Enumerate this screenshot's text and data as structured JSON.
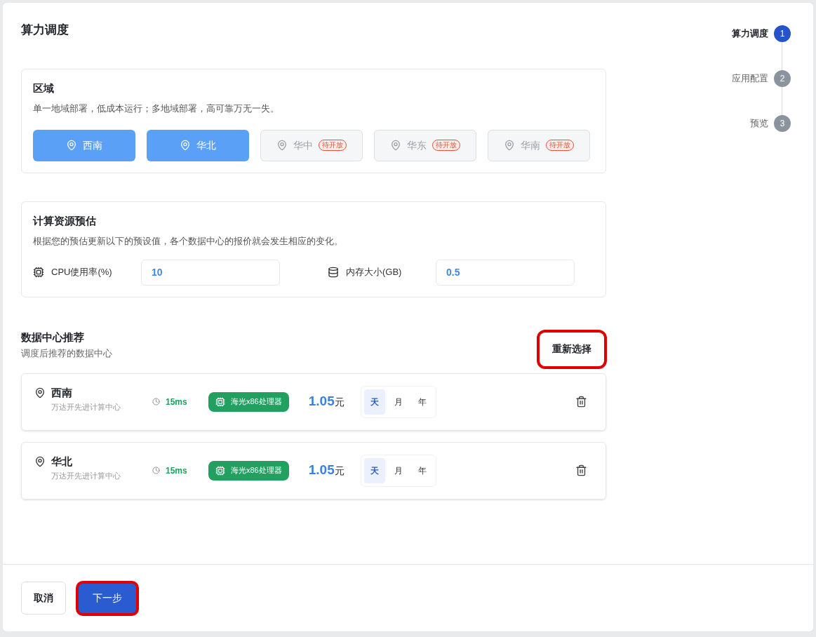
{
  "page_title": "算力调度",
  "steps": [
    {
      "label": "算力调度",
      "number": "1",
      "selected": true
    },
    {
      "label": "应用配置",
      "number": "2",
      "selected": false
    },
    {
      "label": "预览",
      "number": "3",
      "selected": false
    }
  ],
  "region": {
    "title": "区域",
    "description": "单一地域部署，低成本运行；多地域部署，高可靠万无一失。",
    "options": [
      {
        "label": "西南",
        "selected": true,
        "disabled": false
      },
      {
        "label": "华北",
        "selected": true,
        "disabled": false
      },
      {
        "label": "华中",
        "selected": false,
        "disabled": true,
        "badge": "待开放"
      },
      {
        "label": "华东",
        "selected": false,
        "disabled": true,
        "badge": "待开放"
      },
      {
        "label": "华南",
        "selected": false,
        "disabled": true,
        "badge": "待开放"
      }
    ]
  },
  "estimate": {
    "title": "计算资源预估",
    "description": "根据您的预估更新以下的预设值，各个数据中心的报价就会发生相应的变化。",
    "fields": [
      {
        "kind": "cpu",
        "label": "CPU使用率(%)",
        "value": "10"
      },
      {
        "kind": "memory",
        "label": "内存大小(GB)",
        "value": "0.5"
      }
    ]
  },
  "recommend": {
    "title": "数据中心推荐",
    "subtitle": "调度后推荐的数据中心",
    "reselect": {
      "label": "重新选择",
      "highlighted": true
    },
    "centers": [
      {
        "name": "西南",
        "provider": "万达开先进计算中心",
        "latency": "15ms",
        "processor": "海光x86处理器",
        "price": "1.05",
        "unit": "元",
        "periods": [
          {
            "label": "天",
            "selected": true
          },
          {
            "label": "月",
            "selected": false
          },
          {
            "label": "年",
            "selected": false
          }
        ]
      },
      {
        "name": "华北",
        "provider": "万达开先进计算中心",
        "latency": "15ms",
        "processor": "海光x86处理器",
        "price": "1.05",
        "unit": "元",
        "periods": [
          {
            "label": "天",
            "selected": true
          },
          {
            "label": "月",
            "selected": false
          },
          {
            "label": "年",
            "selected": false
          }
        ]
      }
    ]
  },
  "footer": {
    "cancel": {
      "label": "取消"
    },
    "next": {
      "label": "下一步",
      "highlighted": true
    }
  }
}
